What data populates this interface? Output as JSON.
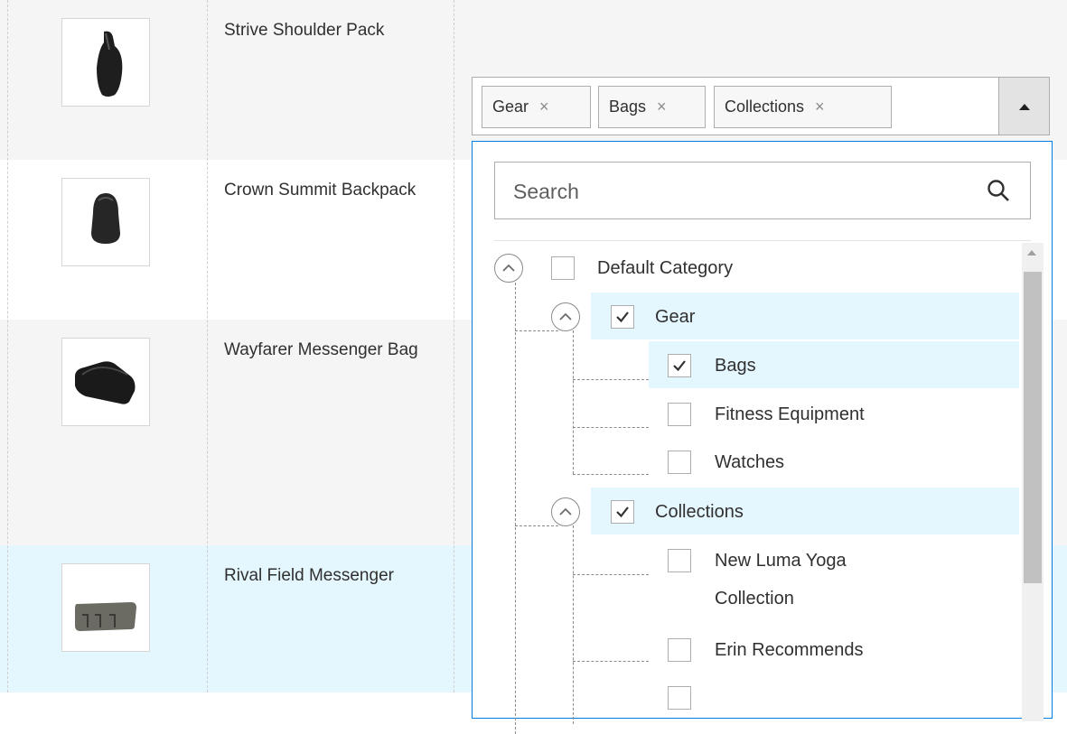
{
  "products": [
    {
      "name": "Strive Shoulder Pack",
      "image": "backpack-sling-image"
    },
    {
      "name": "Crown Summit Backpack",
      "image": "backpack-image"
    },
    {
      "name": "Wayfarer Messenger Bag",
      "image": "messenger-bag-image"
    },
    {
      "name": "Rival Field Messenger",
      "image": "field-messenger-image"
    }
  ],
  "category_select": {
    "selected_chips": [
      {
        "label": "Gear",
        "remove": "×"
      },
      {
        "label": "Bags",
        "remove": "×"
      },
      {
        "label": "Collections",
        "remove": "×"
      }
    ],
    "toggle_icon": "caret-up-icon",
    "search_placeholder": "Search",
    "search_icon": "search-icon",
    "tree": [
      {
        "label": "Default Category",
        "checked": false,
        "expanded": true
      },
      {
        "label": "Gear",
        "checked": true,
        "expanded": true
      },
      {
        "label": "Bags",
        "checked": true
      },
      {
        "label": "Fitness Equipment",
        "checked": false
      },
      {
        "label": "Watches",
        "checked": false
      },
      {
        "label": "Collections",
        "checked": true,
        "expanded": true
      },
      {
        "label": "New Luma Yoga Collection",
        "checked": false
      },
      {
        "label": "Erin Recommends",
        "checked": false
      }
    ]
  },
  "colors": {
    "row_alt": "#f5f5f5",
    "row_selected": "#e5f7fe",
    "dropdown_border": "#007bdb",
    "highlight": "#e5f7fe"
  }
}
